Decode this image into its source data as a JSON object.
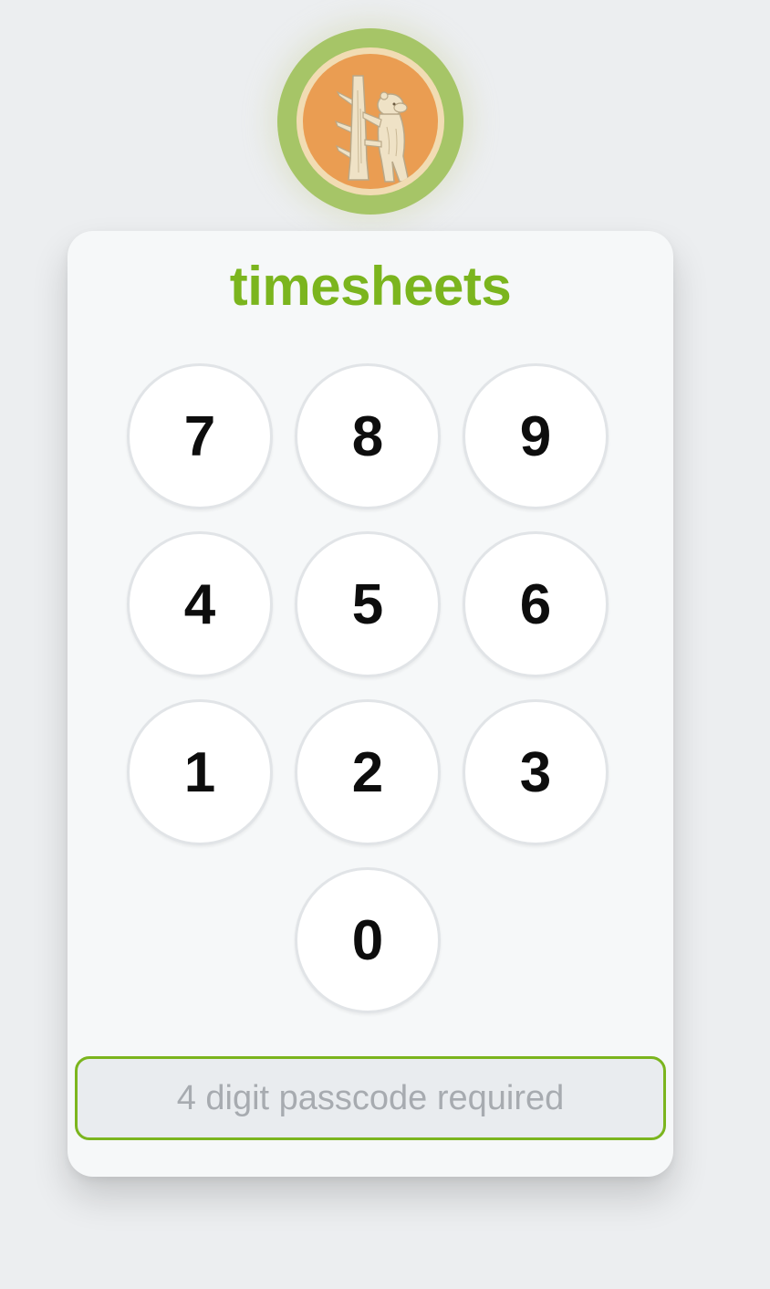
{
  "app": {
    "title": "timesheets",
    "logo_icon": "bear-climbing-tree-logo"
  },
  "keypad": {
    "keys": [
      "7",
      "8",
      "9",
      "4",
      "5",
      "6",
      "1",
      "2",
      "3",
      "0"
    ]
  },
  "passcode": {
    "value": "",
    "placeholder": "4 digit passcode required"
  },
  "colors": {
    "accent": "#7bb51e",
    "logo_ring": "#a6c567",
    "logo_fill": "#ea9d52",
    "background": "#eceef0",
    "card": "#f6f8f9"
  }
}
